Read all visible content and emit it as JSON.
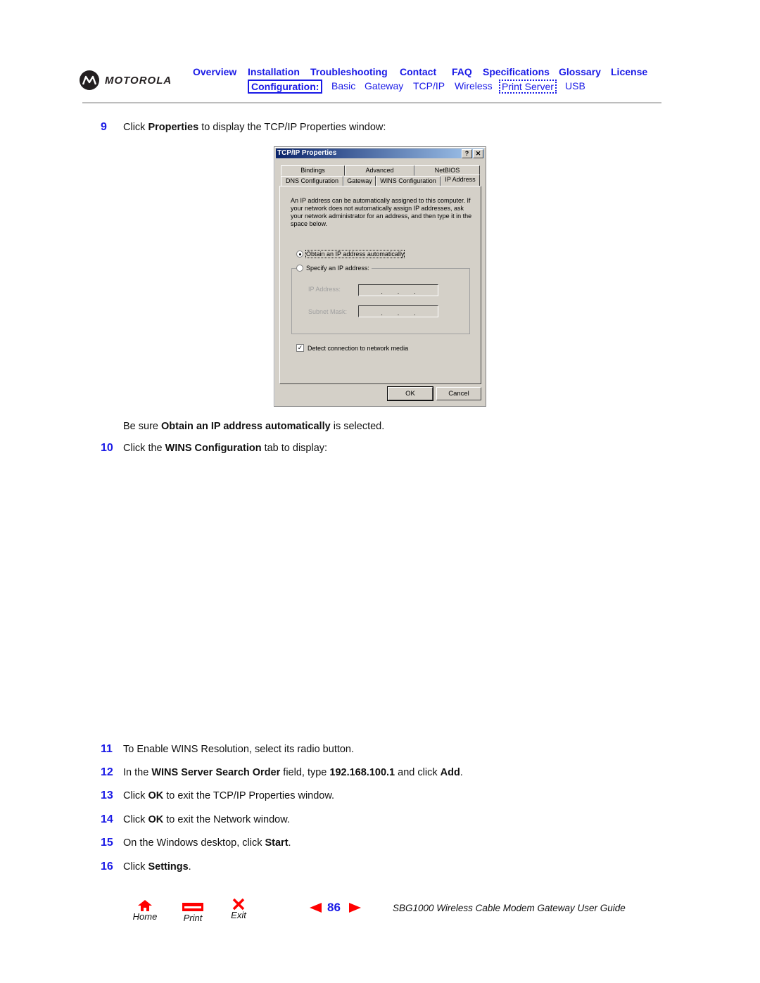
{
  "header": {
    "brand": "MOTOROLA",
    "nav_primary": [
      "Overview",
      "Installation",
      "Troubleshooting",
      "Contact",
      "FAQ",
      "Specifications",
      "Glossary",
      "License"
    ],
    "nav_config_label": "Configuration:",
    "nav_secondary": [
      "Basic",
      "Gateway",
      "TCP/IP",
      "Wireless",
      "Print Server",
      "USB"
    ]
  },
  "steps": {
    "s9": {
      "num": "9",
      "pre": "Click ",
      "bold": "Properties",
      "post": " to display the TCP/IP Properties window:"
    },
    "note": {
      "pre": "Be sure ",
      "bold": "Obtain an IP address automatically",
      "post": " is selected."
    },
    "s10": {
      "num": "10",
      "pre": "Click the ",
      "bold": "WINS Configuration",
      "post": " tab to display:"
    },
    "s11": {
      "num": "11",
      "text": "To Enable WINS Resolution, select its radio button."
    },
    "s12": {
      "num": "12",
      "pre": "In the ",
      "bold1": "WINS Server Search Order",
      "mid1": " field, type ",
      "bold2": "192.168.100.1",
      "mid2": " and click ",
      "bold3": "Add",
      "post": "."
    },
    "s13": {
      "num": "13",
      "pre": "Click ",
      "bold": "OK",
      "post": " to exit the TCP/IP Properties window."
    },
    "s14": {
      "num": "14",
      "pre": "Click ",
      "bold": "OK",
      "post": " to exit the Network window."
    },
    "s15": {
      "num": "15",
      "pre": "On the Windows desktop, click ",
      "bold": "Start",
      "post": "."
    },
    "s16": {
      "num": "16",
      "pre": "Click ",
      "bold": "Settings",
      "post": "."
    }
  },
  "dialog": {
    "title": "TCP/IP Properties",
    "help_btn": "?",
    "close_btn": "✕",
    "tabs_back": [
      "Bindings",
      "Advanced",
      "NetBIOS"
    ],
    "tabs_front": [
      "DNS Configuration",
      "Gateway",
      "WINS Configuration",
      "IP Address"
    ],
    "active_tab": "IP Address",
    "description": "An IP address can be automatically assigned to this computer. If your network does not automatically assign IP addresses, ask your network administrator for an address, and then type it in the space below.",
    "radio_auto": "Obtain an IP address automatically",
    "radio_auto_selected": true,
    "radio_specify": "Specify an IP address:",
    "ip_label": "IP Address:",
    "ip_value": [
      "",
      "",
      "",
      ""
    ],
    "mask_label": "Subnet Mask:",
    "mask_value": [
      "",
      "",
      "",
      ""
    ],
    "checkbox_label": "Detect connection to network media",
    "checkbox_checked": true,
    "ok": "OK",
    "cancel": "Cancel"
  },
  "footer": {
    "home": "Home",
    "print": "Print",
    "exit": "Exit",
    "page": "86",
    "guide_title": "SBG1000 Wireless Cable Modem Gateway User Guide",
    "accent_red": "#ff0000",
    "link_blue": "#1a1ae6"
  }
}
